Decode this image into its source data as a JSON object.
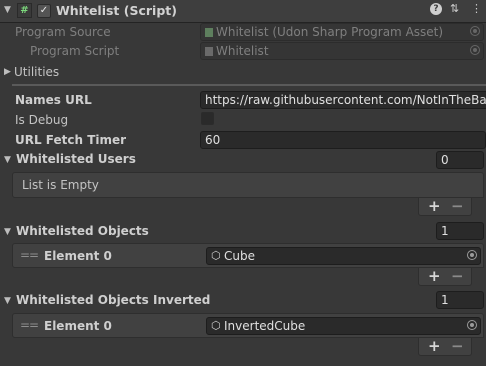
{
  "header": {
    "title": "Whitelist (Script)",
    "script_icon": "script-icon",
    "checkbox_mark": "✓",
    "help_icon": "?",
    "settings_icon": "⇅",
    "menu_icon": "⋮"
  },
  "program_source": {
    "label": "Program Source",
    "value": "Whitelist (Udon Sharp Program Asset)"
  },
  "program_script": {
    "label": "Program Script",
    "value": "Whitelist"
  },
  "utilities": {
    "label": "Utilities"
  },
  "fields": {
    "names_url": {
      "label": "Names URL",
      "value": "https://raw.githubusercontent.com/NotInTheBa"
    },
    "is_debug": {
      "label": "Is Debug"
    },
    "url_fetch_timer": {
      "label": "URL Fetch Timer",
      "value": "60"
    }
  },
  "whitelisted_users": {
    "label": "Whitelisted Users",
    "count": "0",
    "empty_text": "List is Empty"
  },
  "whitelisted_objects": {
    "label": "Whitelisted Objects",
    "count": "1",
    "elements": [
      {
        "label": "Element 0",
        "value": "Cube"
      }
    ]
  },
  "whitelisted_objects_inverted": {
    "label": "Whitelisted Objects Inverted",
    "count": "1",
    "elements": [
      {
        "label": "Element 0",
        "value": "InvertedCube"
      }
    ]
  },
  "list_controls": {
    "plus": "+",
    "minus": "−"
  },
  "colors": {
    "background": "#383838",
    "field": "#2a2a2a",
    "panel": "#414141",
    "script_icon_green": "#7cd87c"
  }
}
